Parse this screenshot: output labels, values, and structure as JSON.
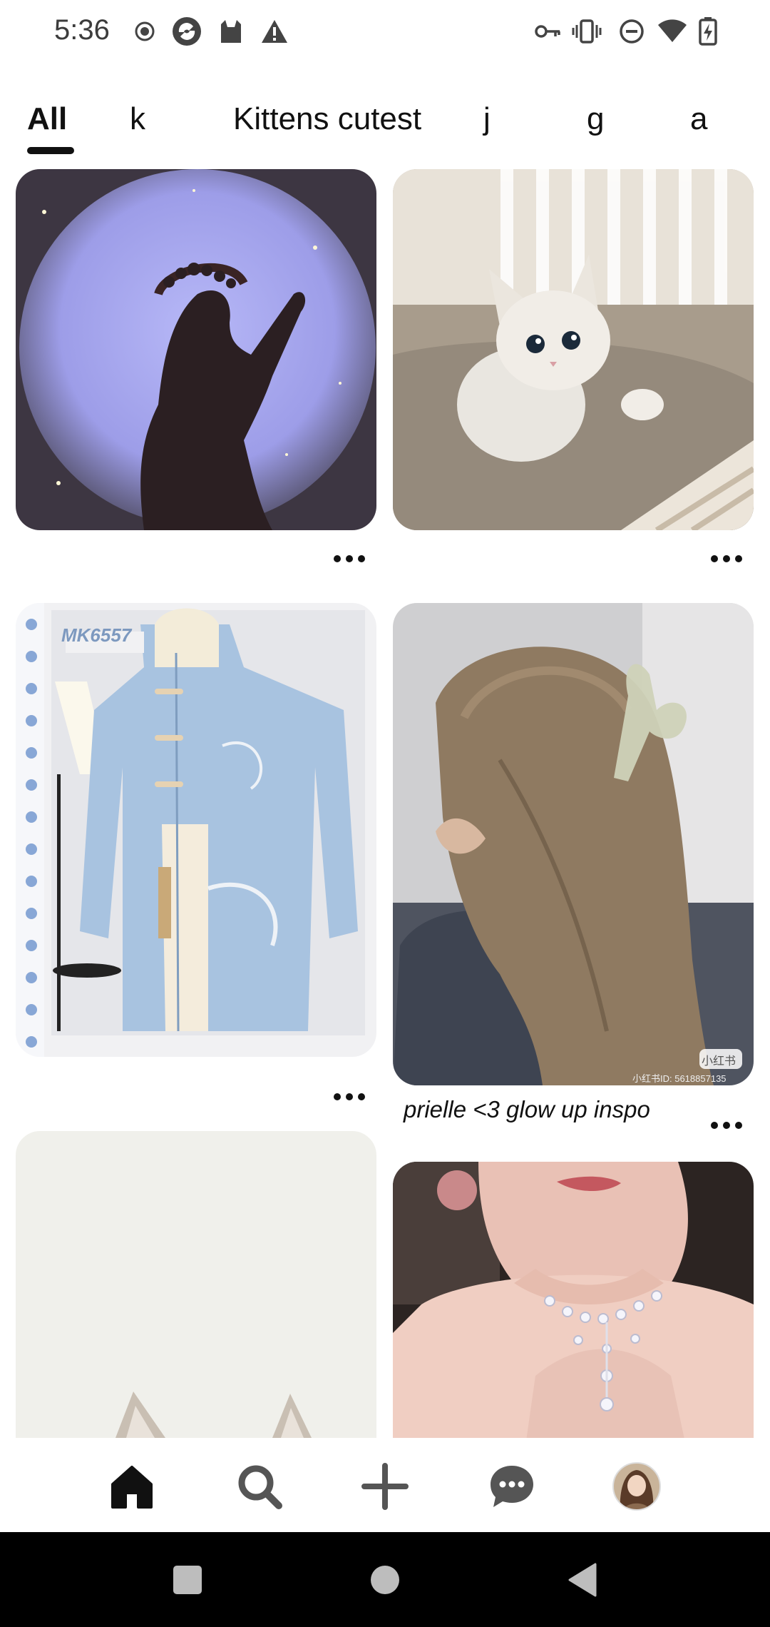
{
  "status_bar": {
    "time": "5:36",
    "left_icons": [
      "record-icon",
      "app-icon",
      "cat-icon",
      "warning-icon"
    ],
    "right_icons": [
      "key-icon",
      "vibrate-icon",
      "do-not-disturb-icon",
      "wifi-icon",
      "battery-charging-icon"
    ]
  },
  "tabs": [
    {
      "label": "All",
      "active": true
    },
    {
      "label": "k"
    },
    {
      "label": "Kittens cutest"
    },
    {
      "label": "j"
    },
    {
      "label": "g"
    },
    {
      "label": "a"
    }
  ],
  "feed": {
    "pins": [
      {
        "image": "girl-silhouette-crown-moon-photo",
        "caption": ""
      },
      {
        "image": "white-kitten-photo",
        "caption": ""
      },
      {
        "image": "blue-embroidered-hoodie-dress-photo",
        "tag_text": "MK6557",
        "caption": ""
      },
      {
        "image": "hair-claw-clip-photo",
        "watermark": "小红书",
        "watermark_id": "小红书ID: 5618857135",
        "caption": "prielle <3 glow up inspo"
      },
      {
        "image": "cat-ears-light-background-photo",
        "caption": ""
      },
      {
        "image": "rhinestone-necklace-photo",
        "caption": ""
      }
    ]
  },
  "bottom_nav": {
    "items": [
      "home-icon",
      "search-icon",
      "add-icon",
      "messages-icon",
      "profile-avatar"
    ],
    "active": "home-icon"
  },
  "system_nav": [
    "recents-button",
    "home-button",
    "back-button"
  ]
}
